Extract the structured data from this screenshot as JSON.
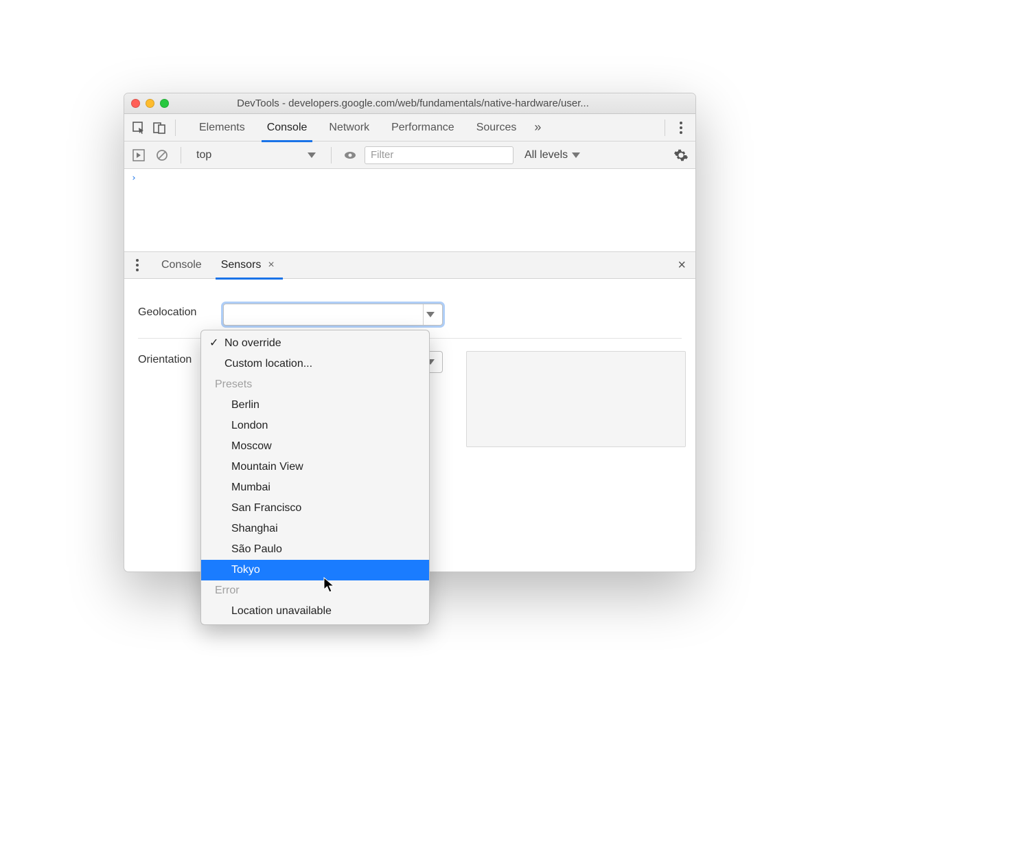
{
  "window": {
    "title": "DevTools - developers.google.com/web/fundamentals/native-hardware/user..."
  },
  "tabs": {
    "items": [
      "Elements",
      "Console",
      "Network",
      "Performance",
      "Sources"
    ],
    "active": "Console"
  },
  "console_toolbar": {
    "context": "top",
    "filter_placeholder": "Filter",
    "levels": "All levels"
  },
  "console_body": {
    "prompt": "›"
  },
  "drawer": {
    "tabs": [
      "Console",
      "Sensors"
    ],
    "active": "Sensors"
  },
  "sensors": {
    "geolocation_label": "Geolocation",
    "orientation_label": "Orientation"
  },
  "dropdown": {
    "top_items": [
      "No override",
      "Custom location..."
    ],
    "checked": "No override",
    "group_presets": "Presets",
    "presets": [
      "Berlin",
      "London",
      "Moscow",
      "Mountain View",
      "Mumbai",
      "San Francisco",
      "Shanghai",
      "São Paulo",
      "Tokyo"
    ],
    "highlighted": "Tokyo",
    "group_error": "Error",
    "error_items": [
      "Location unavailable"
    ]
  }
}
